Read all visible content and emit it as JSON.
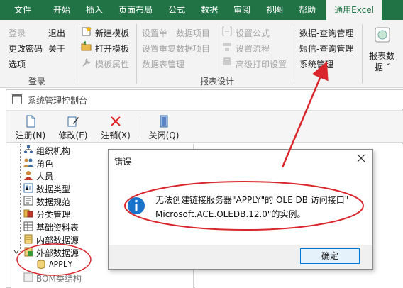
{
  "tabs": [
    "文件",
    "开始",
    "插入",
    "页面布局",
    "公式",
    "数据",
    "审阅",
    "视图",
    "帮助",
    "通用Excel"
  ],
  "ribbon": {
    "login_group": {
      "label": "登录",
      "items": {
        "login": "登录",
        "logout": "退出",
        "change_password": "更改密码",
        "about": "关于",
        "options": "选项"
      }
    },
    "report_group": {
      "label": "报表设计",
      "new_template": "新建模板",
      "open_template": "打开模板",
      "template_props": "模板属性",
      "single_data_item": "设置单一数据项目",
      "repeat_data_item": "设置重复数据项目",
      "data_table_mgmt": "数据表管理",
      "set_formula": "设置公式",
      "set_flow": "设置流程",
      "advanced_print": "高级打印设置",
      "data_query_mgmt": "数据-查询管理",
      "sms_query_mgmt": "短信-查询管理",
      "system_mgmt": "系统管理"
    },
    "report_data": {
      "line1": "报表数",
      "line2": "据 ˇ"
    }
  },
  "console": {
    "title": "系统管理控制台",
    "toolbar": {
      "register": "注册(N)",
      "modify": "修改(E)",
      "unregister": "注销(X)",
      "close": "关闭(Q)"
    },
    "tree": [
      "组织机构",
      "角色",
      "人员",
      "数据类型",
      "数据规范",
      "分类管理",
      "基础资料表",
      "内部数据源",
      "外部数据源",
      "APPLY",
      "BOM类结构"
    ]
  },
  "dialog": {
    "title": "错误",
    "message_line1": "无法创建链接服务器\"APPLY\"的 OLE DB 访问接口\"",
    "message_line2": "Microsoft.ACE.OLEDB.12.0\"的实例。",
    "ok_label": "确定"
  },
  "colors": {
    "brand_green": "#217346",
    "annotation_red": "#d9262c",
    "dialog_accent": "#0078d7"
  }
}
